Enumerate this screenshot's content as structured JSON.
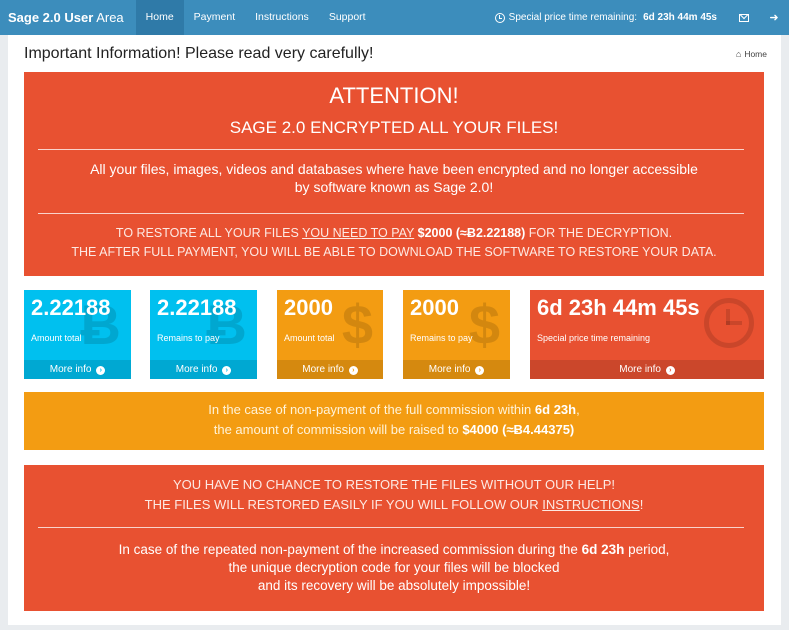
{
  "navbar": {
    "brand_bold": "Sage 2.0 User",
    "brand_rest": "Area",
    "items": [
      {
        "label": "Home"
      },
      {
        "label": "Payment"
      },
      {
        "label": "Instructions"
      },
      {
        "label": "Support"
      }
    ],
    "timer_label": "Special price time remaining:",
    "timer_value": "6d 23h 44m 45s"
  },
  "header": {
    "title": "Important Information! Please read very carefully!",
    "breadcrumb": "Home"
  },
  "attention": {
    "title": "ATTENTION!",
    "subtitle": "SAGE 2.0 ENCRYPTED ALL YOUR FILES!",
    "message_line1": "All your files, images, videos and databases where have been encrypted and no longer accessible",
    "message_line2": "by software known as Sage 2.0!",
    "pay_pre": "TO RESTORE ALL YOUR FILES",
    "pay_link": "YOU NEED TO PAY",
    "pay_amount": "$2000 (≈Ƀ2.22188)",
    "pay_post": "FOR THE DECRYPTION.",
    "pay_line2": "THE AFTER FULL PAYMENT, YOU WILL BE ABLE TO DOWNLOAD THE SOFTWARE TO RESTORE YOUR DATA."
  },
  "boxes": [
    {
      "value": "2.22188",
      "label": "Amount total",
      "more": "More info",
      "ghost": "Ƀ"
    },
    {
      "value": "2.22188",
      "label": "Remains to pay",
      "more": "More info",
      "ghost": "Ƀ"
    },
    {
      "value": "2000",
      "label": "Amount total",
      "more": "More info",
      "ghost": "$"
    },
    {
      "value": "2000",
      "label": "Remains to pay",
      "more": "More info",
      "ghost": "$"
    },
    {
      "value": "6d 23h 44m 45s",
      "label": "Special price time remaining",
      "more": "More info"
    }
  ],
  "warning": {
    "line1_pre": "In the case of non-payment of the full commission within",
    "line1_bold": "6d 23h",
    "line1_post": ",",
    "line2_pre": "the amount of commission will be raised to",
    "line2_bold": "$4000 (≈Ƀ4.44375)"
  },
  "final": {
    "line1": "YOU HAVE NO CHANCE TO RESTORE THE FILES WITHOUT OUR HELP!",
    "line2_pre": "THE FILES WILL RESTORED EASILY IF YOU WILL FOLLOW OUR",
    "line2_link": "INSTRUCTIONS",
    "line2_post": "!",
    "bottom_pre": "In case of the repeated non-payment of the increased commission during the",
    "bottom_bold": "6d 23h",
    "bottom_post": "period,",
    "bottom_line2": "the unique decryption code for your files will be blocked",
    "bottom_line3": "and its recovery will be absolutely impossible!"
  },
  "colors": {
    "navbar": "#3c8dbc",
    "red": "#e85131",
    "blue": "#00c0ef",
    "orange": "#f39c12"
  }
}
